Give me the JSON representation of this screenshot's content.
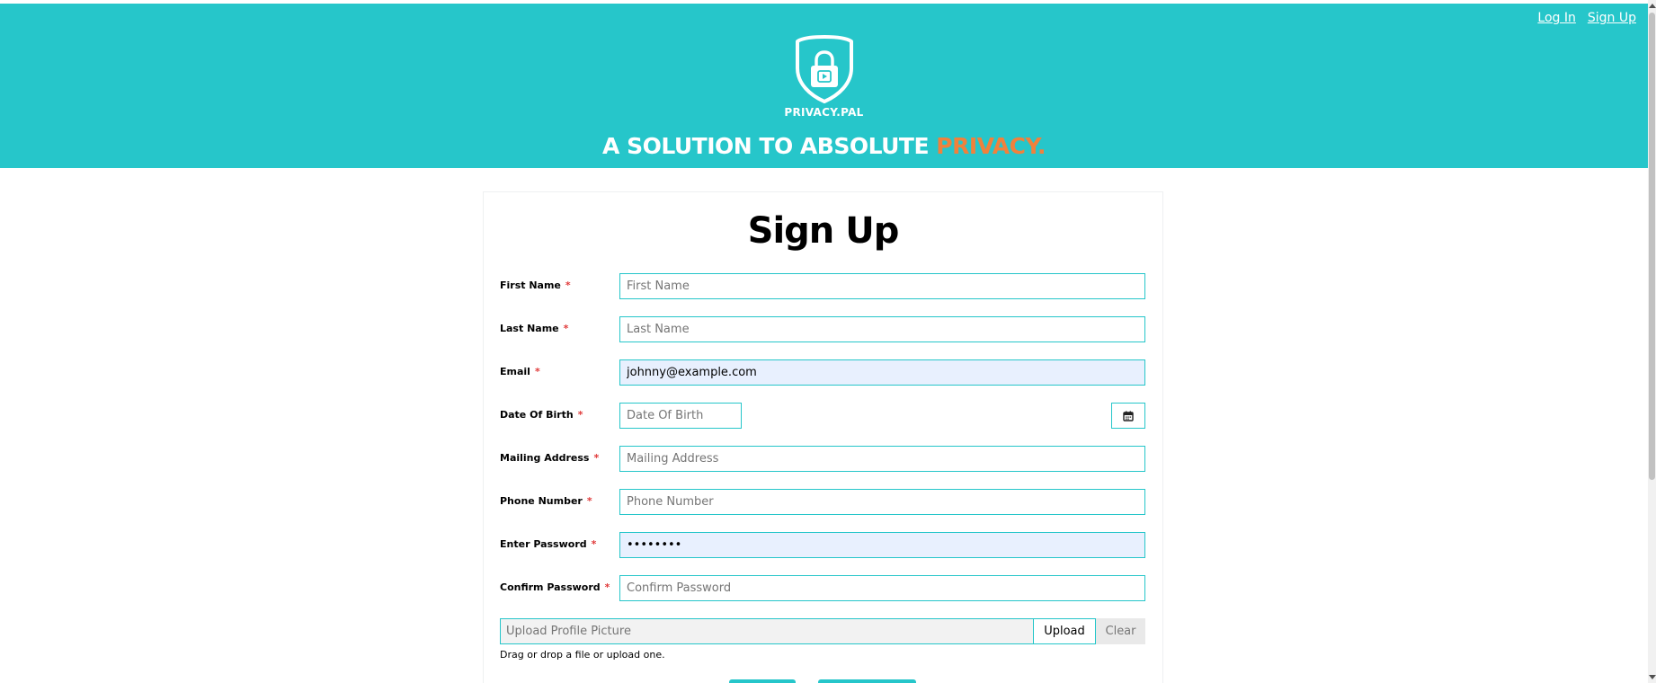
{
  "nav": {
    "login": "Log In",
    "signup": "Sign Up"
  },
  "brand": {
    "name": "PRIVACY.PAL",
    "tagline_prefix": "A SOLUTION TO ABSOLUTE",
    "tagline_accent": "PRIVACY."
  },
  "colors": {
    "primary": "#26c6ca",
    "accent": "#f0813c",
    "required": "#e03a3a",
    "autofill": "#e8f0fe"
  },
  "form": {
    "title": "Sign Up",
    "required_mark": "*",
    "fields": {
      "first_name": {
        "label": "First Name",
        "placeholder": "First Name",
        "value": ""
      },
      "last_name": {
        "label": "Last Name",
        "placeholder": "Last Name",
        "value": ""
      },
      "email": {
        "label": "Email",
        "placeholder": "Email",
        "value": "johnny@example.com"
      },
      "dob": {
        "label": "Date Of Birth",
        "placeholder": "Date Of Birth",
        "value": "",
        "icon": "calendar-icon"
      },
      "mailing_address": {
        "label": "Mailing Address",
        "placeholder": "Mailing Address",
        "value": ""
      },
      "phone": {
        "label": "Phone Number",
        "placeholder": "Phone Number",
        "value": ""
      },
      "password": {
        "label": "Enter Password",
        "placeholder": "Enter Password",
        "value": "••••••••"
      },
      "confirm_password": {
        "label": "Confirm Password",
        "placeholder": "Confirm Password",
        "value": ""
      }
    },
    "upload": {
      "placeholder": "Upload Profile Picture",
      "upload_label": "Upload",
      "clear_label": "Clear",
      "hint": "Drag or drop a file or upload one."
    }
  }
}
